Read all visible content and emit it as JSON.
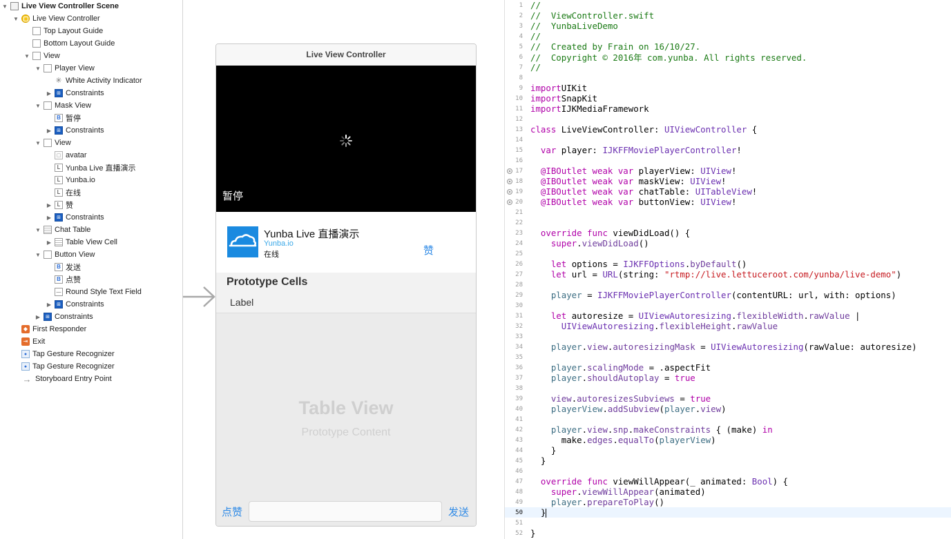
{
  "outline": {
    "items": [
      {
        "label": "Live View Controller Scene",
        "level": 0,
        "tri": "▼",
        "icon": "scene",
        "bold": true
      },
      {
        "label": "Live View Controller",
        "level": 1,
        "tri": "▼",
        "icon": "vc"
      },
      {
        "label": "Top Layout Guide",
        "level": 2,
        "tri": "",
        "icon": "view"
      },
      {
        "label": "Bottom Layout Guide",
        "level": 2,
        "tri": "",
        "icon": "view"
      },
      {
        "label": "View",
        "level": 2,
        "tri": "▼",
        "icon": "view"
      },
      {
        "label": "Player View",
        "level": 3,
        "tri": "▼",
        "icon": "view"
      },
      {
        "label": "White Activity Indicator",
        "level": 4,
        "tri": "",
        "icon": "act"
      },
      {
        "label": "Constraints",
        "level": 4,
        "tri": "▶",
        "icon": "cons"
      },
      {
        "label": "Mask View",
        "level": 3,
        "tri": "▼",
        "icon": "view"
      },
      {
        "label": "暂停",
        "level": 4,
        "tri": "",
        "icon": "btn"
      },
      {
        "label": "Constraints",
        "level": 4,
        "tri": "▶",
        "icon": "cons"
      },
      {
        "label": "View",
        "level": 3,
        "tri": "▼",
        "icon": "view"
      },
      {
        "label": "avatar",
        "level": 4,
        "tri": "",
        "icon": "img"
      },
      {
        "label": "Yunba Live 直播演示",
        "level": 4,
        "tri": "",
        "icon": "lbl"
      },
      {
        "label": "Yunba.io",
        "level": 4,
        "tri": "",
        "icon": "lbl"
      },
      {
        "label": "在线",
        "level": 4,
        "tri": "",
        "icon": "lbl"
      },
      {
        "label": "赞",
        "level": 4,
        "tri": "▶",
        "icon": "lbl"
      },
      {
        "label": "Constraints",
        "level": 4,
        "tri": "▶",
        "icon": "cons"
      },
      {
        "label": "Chat Table",
        "level": 3,
        "tri": "▼",
        "icon": "table"
      },
      {
        "label": "Table View Cell",
        "level": 4,
        "tri": "▶",
        "icon": "cell"
      },
      {
        "label": "Button View",
        "level": 3,
        "tri": "▼",
        "icon": "view"
      },
      {
        "label": "发送",
        "level": 4,
        "tri": "",
        "icon": "btn"
      },
      {
        "label": "点赞",
        "level": 4,
        "tri": "",
        "icon": "btn"
      },
      {
        "label": "Round Style Text Field",
        "level": 4,
        "tri": "",
        "icon": "tf"
      },
      {
        "label": "Constraints",
        "level": 4,
        "tri": "▶",
        "icon": "cons"
      },
      {
        "label": "Constraints",
        "level": 3,
        "tri": "▶",
        "icon": "cons"
      },
      {
        "label": "First Responder",
        "level": 1,
        "tri": "",
        "icon": "first"
      },
      {
        "label": "Exit",
        "level": 1,
        "tri": "",
        "icon": "exit"
      },
      {
        "label": "Tap Gesture Recognizer",
        "level": 1,
        "tri": "",
        "icon": "tap"
      },
      {
        "label": "Tap Gesture Recognizer",
        "level": 1,
        "tri": "",
        "icon": "tap"
      },
      {
        "label": "Storyboard Entry Point",
        "level": 1,
        "tri": "",
        "icon": "entry"
      }
    ]
  },
  "canvas": {
    "scene_title": "Live View Controller",
    "pause_label": "暂停",
    "info_title": "Yunba Live 直播演示",
    "info_site": "Yunba.io",
    "info_status": "在线",
    "like_label": "赞",
    "proto_title": "Prototype Cells",
    "proto_label": "Label",
    "table_title": "Table View",
    "table_subtitle": "Prototype Content",
    "btn_like": "点赞",
    "btn_send": "发送"
  },
  "editor": {
    "current_line": 50,
    "breakpoint_lines": [
      17,
      18,
      19,
      20
    ],
    "lines": [
      [
        [
          "c",
          "//"
        ]
      ],
      [
        [
          "c",
          "//  ViewController.swift"
        ]
      ],
      [
        [
          "c",
          "//  YunbaLiveDemo"
        ]
      ],
      [
        [
          "c",
          "//"
        ]
      ],
      [
        [
          "c",
          "//  Created by Frain on 16/10/27."
        ]
      ],
      [
        [
          "c",
          "//  Copyright © 2016年 com.yunba. All rights reserved."
        ]
      ],
      [
        [
          "c",
          "//"
        ]
      ],
      [],
      [
        [
          "k",
          "import"
        ],
        [
          "",
          "UIKit"
        ]
      ],
      [
        [
          "k",
          "import"
        ],
        [
          "",
          "SnapKit"
        ]
      ],
      [
        [
          "k",
          "import"
        ],
        [
          "",
          "IJKMediaFramework"
        ]
      ],
      [],
      [
        [
          "k",
          "class"
        ],
        [
          "",
          " LiveViewController: "
        ],
        [
          "t",
          "UIViewController"
        ],
        [
          "",
          " {"
        ]
      ],
      [],
      [
        [
          "",
          "  "
        ],
        [
          "k",
          "var"
        ],
        [
          "",
          " player: "
        ],
        [
          "t",
          "IJKFFMoviePlayerController"
        ],
        [
          "",
          "!"
        ]
      ],
      [],
      [
        [
          "",
          "  "
        ],
        [
          "k",
          "@IBOutlet weak var"
        ],
        [
          "",
          " playerView: "
        ],
        [
          "t",
          "UIView"
        ],
        [
          "",
          "!"
        ]
      ],
      [
        [
          "",
          "  "
        ],
        [
          "k",
          "@IBOutlet weak var"
        ],
        [
          "",
          " maskView: "
        ],
        [
          "t",
          "UIView"
        ],
        [
          "",
          "!"
        ]
      ],
      [
        [
          "",
          "  "
        ],
        [
          "k",
          "@IBOutlet weak var"
        ],
        [
          "",
          " chatTable: "
        ],
        [
          "t",
          "UITableView"
        ],
        [
          "",
          "!"
        ]
      ],
      [
        [
          "",
          "  "
        ],
        [
          "k",
          "@IBOutlet weak var"
        ],
        [
          "",
          " buttonView: "
        ],
        [
          "t",
          "UIView"
        ],
        [
          "",
          "!"
        ]
      ],
      [],
      [],
      [
        [
          "",
          "  "
        ],
        [
          "k",
          "override func"
        ],
        [
          "",
          " viewDidLoad() {"
        ]
      ],
      [
        [
          "",
          "    "
        ],
        [
          "k",
          "super"
        ],
        [
          "",
          "."
        ],
        [
          "p",
          "viewDidLoad"
        ],
        [
          "",
          "()"
        ]
      ],
      [],
      [
        [
          "",
          "    "
        ],
        [
          "k",
          "let"
        ],
        [
          "",
          " options = "
        ],
        [
          "t",
          "IJKFFOptions"
        ],
        [
          "",
          "."
        ],
        [
          "p",
          "byDefault"
        ],
        [
          "",
          "()"
        ]
      ],
      [
        [
          "",
          "    "
        ],
        [
          "k",
          "let"
        ],
        [
          "",
          " url = "
        ],
        [
          "t",
          "URL"
        ],
        [
          "",
          "(string: "
        ],
        [
          "s",
          "\"rtmp://live.lettuceroot.com/yunba/live-demo\""
        ],
        [
          "",
          ")"
        ]
      ],
      [],
      [
        [
          "",
          "    "
        ],
        [
          "f",
          "player"
        ],
        [
          "",
          " = "
        ],
        [
          "t",
          "IJKFFMoviePlayerController"
        ],
        [
          "",
          "(contentURL: url, with: options)"
        ]
      ],
      [],
      [
        [
          "",
          "    "
        ],
        [
          "k",
          "let"
        ],
        [
          "",
          " autoresize = "
        ],
        [
          "t",
          "UIViewAutoresizing"
        ],
        [
          "",
          "."
        ],
        [
          "p",
          "flexibleWidth"
        ],
        [
          "",
          "."
        ],
        [
          "p",
          "rawValue"
        ],
        [
          "",
          " |"
        ]
      ],
      [
        [
          "",
          "      "
        ],
        [
          "t",
          "UIViewAutoresizing"
        ],
        [
          "",
          "."
        ],
        [
          "p",
          "flexibleHeight"
        ],
        [
          "",
          "."
        ],
        [
          "p",
          "rawValue"
        ]
      ],
      [],
      [
        [
          "",
          "    "
        ],
        [
          "f",
          "player"
        ],
        [
          "",
          "."
        ],
        [
          "p",
          "view"
        ],
        [
          "",
          "."
        ],
        [
          "p",
          "autoresizingMask"
        ],
        [
          "",
          " = "
        ],
        [
          "t",
          "UIViewAutoresizing"
        ],
        [
          "",
          "(rawValue: autoresize)"
        ]
      ],
      [],
      [
        [
          "",
          "    "
        ],
        [
          "f",
          "player"
        ],
        [
          "",
          "."
        ],
        [
          "p",
          "scalingMode"
        ],
        [
          "",
          " = ."
        ],
        [
          "",
          "aspectFit"
        ]
      ],
      [
        [
          "",
          "    "
        ],
        [
          "f",
          "player"
        ],
        [
          "",
          "."
        ],
        [
          "p",
          "shouldAutoplay"
        ],
        [
          "",
          " = "
        ],
        [
          "k",
          "true"
        ]
      ],
      [],
      [
        [
          "",
          "    "
        ],
        [
          "p",
          "view"
        ],
        [
          "",
          "."
        ],
        [
          "p",
          "autoresizesSubviews"
        ],
        [
          "",
          " = "
        ],
        [
          "k",
          "true"
        ]
      ],
      [
        [
          "",
          "    "
        ],
        [
          "f",
          "playerView"
        ],
        [
          "",
          "."
        ],
        [
          "p",
          "addSubview"
        ],
        [
          "",
          "("
        ],
        [
          "f",
          "player"
        ],
        [
          "",
          "."
        ],
        [
          "p",
          "view"
        ],
        [
          "",
          ")"
        ]
      ],
      [],
      [
        [
          "",
          "    "
        ],
        [
          "f",
          "player"
        ],
        [
          "",
          "."
        ],
        [
          "p",
          "view"
        ],
        [
          "",
          "."
        ],
        [
          "p",
          "snp"
        ],
        [
          "",
          "."
        ],
        [
          "p",
          "makeConstraints"
        ],
        [
          "",
          " { (make) "
        ],
        [
          "k",
          "in"
        ]
      ],
      [
        [
          "",
          "      make."
        ],
        [
          "p",
          "edges"
        ],
        [
          "",
          "."
        ],
        [
          "p",
          "equalTo"
        ],
        [
          "",
          "("
        ],
        [
          "f",
          "playerView"
        ],
        [
          "",
          ")"
        ]
      ],
      [
        [
          "",
          "    }"
        ]
      ],
      [
        [
          "",
          "  }"
        ]
      ],
      [],
      [
        [
          "",
          "  "
        ],
        [
          "k",
          "override func"
        ],
        [
          "",
          " viewWillAppear(_ animated: "
        ],
        [
          "t",
          "Bool"
        ],
        [
          "",
          ") {"
        ]
      ],
      [
        [
          "",
          "    "
        ],
        [
          "k",
          "super"
        ],
        [
          "",
          "."
        ],
        [
          "p",
          "viewWillAppear"
        ],
        [
          "",
          "(animated)"
        ]
      ],
      [
        [
          "",
          "    "
        ],
        [
          "f",
          "player"
        ],
        [
          "",
          "."
        ],
        [
          "p",
          "prepareToPlay"
        ],
        [
          "",
          "()"
        ]
      ],
      [
        [
          "",
          "  }"
        ],
        [
          "caret",
          ""
        ]
      ],
      [],
      [
        [
          "",
          "}"
        ]
      ]
    ]
  }
}
